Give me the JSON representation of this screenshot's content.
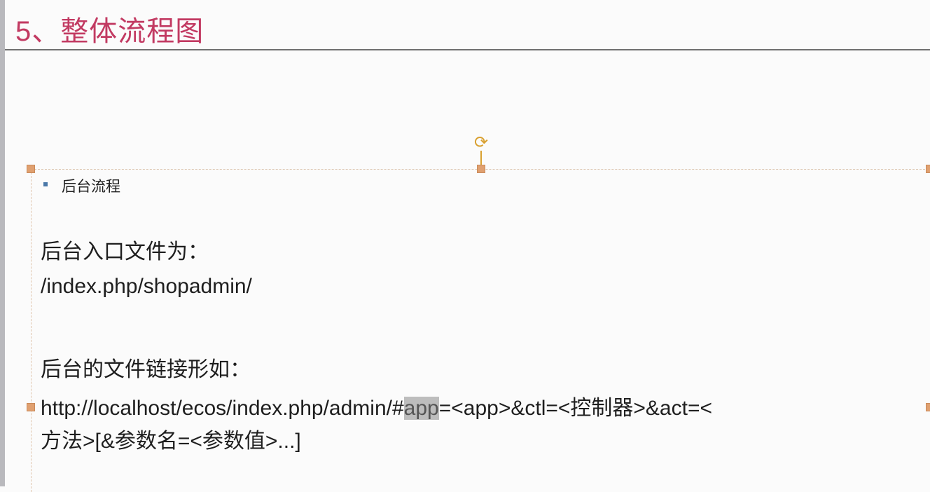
{
  "slide": {
    "title": "5、整体流程图",
    "subheading": "后台流程",
    "entry_label": "后台入口文件为：",
    "entry_path": "/index.php/shopadmin/",
    "link_label": "后台的文件链接形如：",
    "url_line1_prefix": "http://localhost/ecos/index.php/admin/#",
    "url_line1_highlight": "app",
    "url_line1_suffix": "=<app>&ctl=<控制器>&act=<",
    "url_line2": "方法>[&参数名=<参数值>...]"
  },
  "colors": {
    "title": "#c23a62",
    "selection_handle": "#e0a070",
    "rotate_handle": "#d9a030",
    "highlight": "#bdbdbd"
  }
}
